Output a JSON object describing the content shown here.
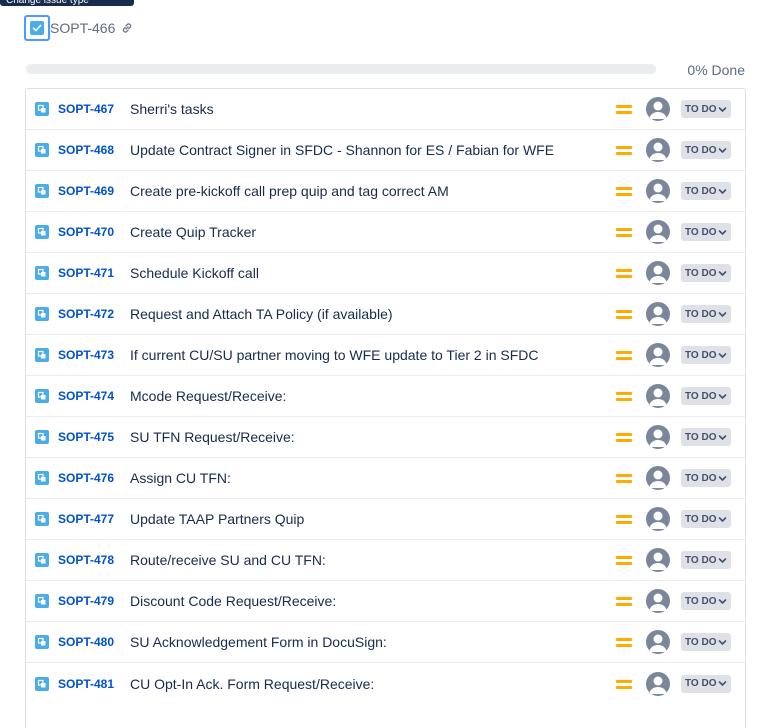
{
  "tooltip": {
    "text": "Change issue type"
  },
  "parent": {
    "key": "SOPT-466",
    "type_icon": "subtask-checkbox-icon",
    "link_icon": "link-icon"
  },
  "progress": {
    "fraction": 0,
    "label": "0% Done",
    "fill_color": "#36b37e"
  },
  "colors": {
    "accent": "#0052cc",
    "subtask": "#4bade8",
    "priority_medium": "#ffab00",
    "status_bg": "#dfe1e6"
  },
  "issues": [
    {
      "key": "SOPT-467",
      "summary": "Sherri's tasks",
      "status": "TO DO",
      "priority": "medium"
    },
    {
      "key": "SOPT-468",
      "summary": "Update Contract Signer in SFDC - Shannon for ES / Fabian for WFE",
      "status": "TO DO",
      "priority": "medium"
    },
    {
      "key": "SOPT-469",
      "summary": "Create pre-kickoff call prep quip and tag correct AM",
      "status": "TO DO",
      "priority": "medium"
    },
    {
      "key": "SOPT-470",
      "summary": "Create Quip Tracker",
      "status": "TO DO",
      "priority": "medium"
    },
    {
      "key": "SOPT-471",
      "summary": "Schedule Kickoff call",
      "status": "TO DO",
      "priority": "medium"
    },
    {
      "key": "SOPT-472",
      "summary": "Request and Attach TA Policy (if available)",
      "status": "TO DO",
      "priority": "medium"
    },
    {
      "key": "SOPT-473",
      "summary": "If current CU/SU partner moving to WFE update to Tier 2 in SFDC",
      "status": "TO DO",
      "priority": "medium"
    },
    {
      "key": "SOPT-474",
      "summary": "Mcode Request/Receive:",
      "status": "TO DO",
      "priority": "medium"
    },
    {
      "key": "SOPT-475",
      "summary": "SU TFN Request/Receive:",
      "status": "TO DO",
      "priority": "medium"
    },
    {
      "key": "SOPT-476",
      "summary": "Assign CU TFN:",
      "status": "TO DO",
      "priority": "medium"
    },
    {
      "key": "SOPT-477",
      "summary": "Update TAAP Partners Quip",
      "status": "TO DO",
      "priority": "medium"
    },
    {
      "key": "SOPT-478",
      "summary": "Route/receive SU and CU TFN:",
      "status": "TO DO",
      "priority": "medium"
    },
    {
      "key": "SOPT-479",
      "summary": "Discount Code Request/Receive:",
      "status": "TO DO",
      "priority": "medium"
    },
    {
      "key": "SOPT-480",
      "summary": "SU Acknowledgement Form in DocuSign:",
      "status": "TO DO",
      "priority": "medium"
    },
    {
      "key": "SOPT-481",
      "summary": "CU Opt-In Ack. Form Request/Receive:",
      "status": "TO DO",
      "priority": "medium"
    }
  ]
}
